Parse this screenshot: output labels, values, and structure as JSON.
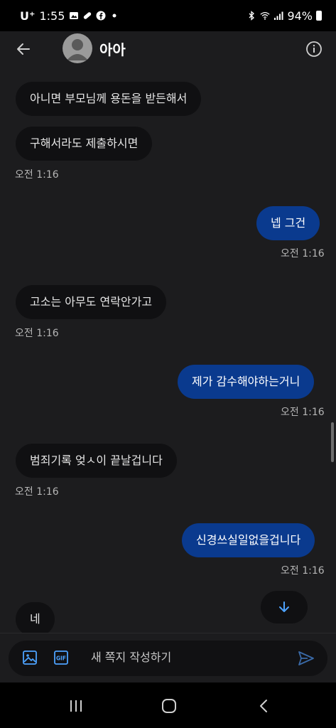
{
  "status_bar": {
    "carrier": "U⁺",
    "time": "1:55",
    "battery": "94%"
  },
  "header": {
    "title": "아아",
    "back_icon": "arrow-left-icon",
    "info_icon": "info-icon"
  },
  "messages": [
    {
      "direction": "in",
      "text": "아니면 부모님께 용돈을 받든해서"
    },
    {
      "direction": "in",
      "text": "구해서라도 제출하시면",
      "time": "오전 1:16"
    },
    {
      "direction": "out",
      "text": "넵 그건",
      "time": "오전 1:16"
    },
    {
      "direction": "in",
      "text": "고소는 아무도 연락안가고",
      "time": "오전 1:16"
    },
    {
      "direction": "out",
      "text": "제가 감수해야하는거니",
      "time": "오전 1:16"
    },
    {
      "direction": "in",
      "text": "범죄기록 엊ㅅ이 끝날겁니다",
      "time": "오전 1:16"
    },
    {
      "direction": "out",
      "text": "신경쓰실일없을겁니다",
      "time": "오전 1:16"
    },
    {
      "direction": "in",
      "text": "네"
    }
  ],
  "composer": {
    "placeholder": "새 쪽지 작성하기",
    "gif_label": "GIF"
  },
  "colors": {
    "accent": "#4da3ff",
    "outgoing_bubble": "#0a3a8e",
    "incoming_bubble": "#101012",
    "background": "#1c1c1e"
  }
}
